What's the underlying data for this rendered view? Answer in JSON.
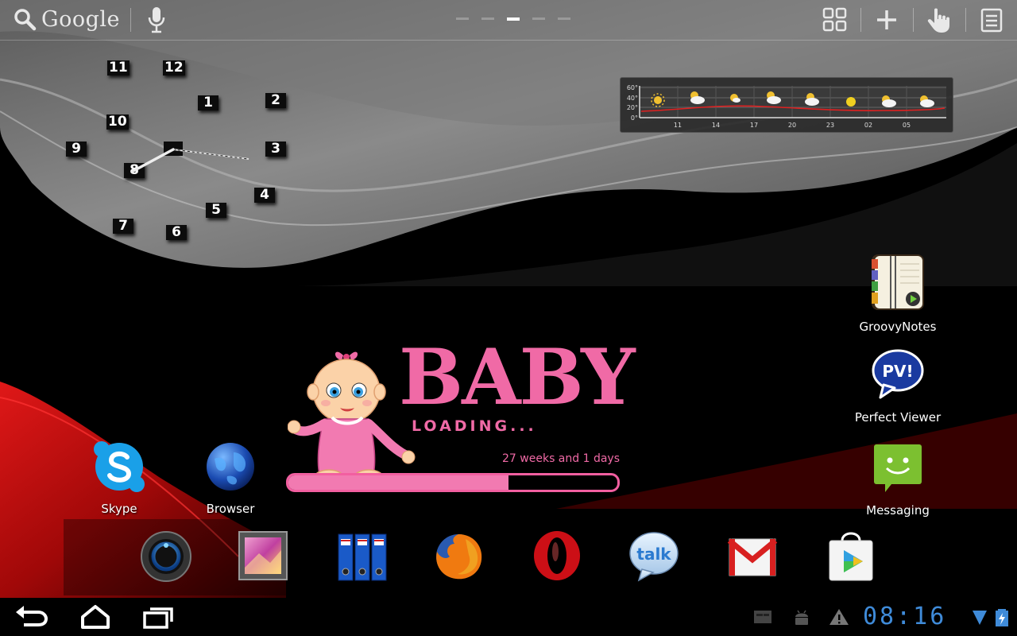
{
  "top_bar": {
    "search_label": "Google",
    "page_indicator": {
      "count": 5,
      "active_index": 2
    }
  },
  "clock_widget": {
    "numerals": [
      "11",
      "12",
      "1",
      "2",
      "10",
      "9",
      "3",
      "8",
      "4",
      "5",
      "7",
      "6"
    ]
  },
  "weather_widget": {
    "y_ticks": [
      "60°",
      "40°",
      "20°",
      "0°"
    ],
    "x_ticks": [
      "11",
      "14",
      "17",
      "20",
      "23",
      "02",
      "05"
    ],
    "icons": [
      "sun-icon",
      "partly-cloudy-icon",
      "sun-icon",
      "partly-cloudy-icon",
      "partly-cloudy-icon",
      "sun-icon",
      "partly-cloudy-icon",
      "partly-cloudy-icon"
    ]
  },
  "home_apps": {
    "groovynotes": "GroovyNotes",
    "perfect_viewer": "Perfect Viewer",
    "perfect_viewer_badge": "PV!",
    "messaging": "Messaging",
    "skype": "Skype",
    "browser": "Browser"
  },
  "baby_widget": {
    "title": "BABY",
    "subtitle": "LOADING...",
    "weeks_text": "27 weeks and 1 days",
    "progress": 0.67
  },
  "dock": {
    "talk_label": "talk",
    "icons": [
      "blue-orb-app-icon",
      "gallery-icon",
      "binders-app-icon",
      "firefox-icon",
      "opera-icon",
      "google-talk-icon",
      "gmail-icon",
      "play-store-icon"
    ]
  },
  "status_bar": {
    "time": "08:16"
  },
  "colors": {
    "baby_pink": "#f06aa6",
    "clock_blue": "#3f8bd9",
    "wallpaper_red": "#d01010"
  }
}
